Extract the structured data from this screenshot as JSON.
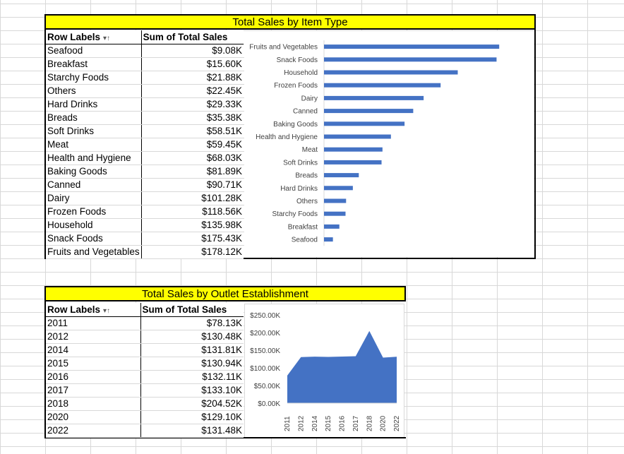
{
  "item_type_section": {
    "title": "Total Sales by Item Type",
    "header_row_labels": "Row Labels",
    "header_sum": "Sum of Total Sales",
    "rows": [
      {
        "label": "Seafood",
        "value": "$9.08K"
      },
      {
        "label": "Breakfast",
        "value": "$15.60K"
      },
      {
        "label": "Starchy Foods",
        "value": "$21.88K"
      },
      {
        "label": "Others",
        "value": "$22.45K"
      },
      {
        "label": "Hard Drinks",
        "value": "$29.33K"
      },
      {
        "label": "Breads",
        "value": "$35.38K"
      },
      {
        "label": "Soft Drinks",
        "value": "$58.51K"
      },
      {
        "label": "Meat",
        "value": "$59.45K"
      },
      {
        "label": "Health and Hygiene",
        "value": "$68.03K"
      },
      {
        "label": "Baking Goods",
        "value": "$81.89K"
      },
      {
        "label": "Canned",
        "value": "$90.71K"
      },
      {
        "label": "Dairy",
        "value": "$101.28K"
      },
      {
        "label": "Frozen Foods",
        "value": "$118.56K"
      },
      {
        "label": "Household",
        "value": "$135.98K"
      },
      {
        "label": "Snack Foods",
        "value": "$175.43K"
      },
      {
        "label": "Fruits and Vegetables",
        "value": "$178.12K"
      }
    ]
  },
  "outlet_section": {
    "title": "Total Sales by Outlet Establishment",
    "header_row_labels": "Row Labels",
    "header_sum": "Sum of Total Sales",
    "rows": [
      {
        "label": "2011",
        "value": "$78.13K"
      },
      {
        "label": "2012",
        "value": "$130.48K"
      },
      {
        "label": "2014",
        "value": "$131.81K"
      },
      {
        "label": "2015",
        "value": "$130.94K"
      },
      {
        "label": "2016",
        "value": "$132.11K"
      },
      {
        "label": "2017",
        "value": "$133.10K"
      },
      {
        "label": "2018",
        "value": "$204.52K"
      },
      {
        "label": "2020",
        "value": "$129.10K"
      },
      {
        "label": "2022",
        "value": "$131.48K"
      }
    ]
  },
  "chart_data": [
    {
      "type": "bar",
      "orientation": "horizontal",
      "categories": [
        "Fruits and Vegetables",
        "Snack Foods",
        "Household",
        "Frozen Foods",
        "Dairy",
        "Canned",
        "Baking Goods",
        "Health and Hygiene",
        "Meat",
        "Soft Drinks",
        "Breads",
        "Hard Drinks",
        "Others",
        "Starchy Foods",
        "Breakfast",
        "Seafood"
      ],
      "values": [
        178.12,
        175.43,
        135.98,
        118.56,
        101.28,
        90.71,
        81.89,
        68.03,
        59.45,
        58.51,
        35.38,
        29.33,
        22.45,
        21.88,
        15.6,
        9.08
      ],
      "color": "#4472c4",
      "grid": false
    },
    {
      "type": "area",
      "x": [
        "2011",
        "2012",
        "2014",
        "2015",
        "2016",
        "2017",
        "2018",
        "2020",
        "2022"
      ],
      "values": [
        78.13,
        130.48,
        131.81,
        130.94,
        132.11,
        133.1,
        204.52,
        129.1,
        131.48
      ],
      "y_ticks": [
        "$0.00K",
        "$50.00K",
        "$100.00K",
        "$150.00K",
        "$200.00K",
        "$250.00K"
      ],
      "ylim": [
        0,
        250
      ],
      "color": "#4472c4",
      "grid": false
    }
  ]
}
